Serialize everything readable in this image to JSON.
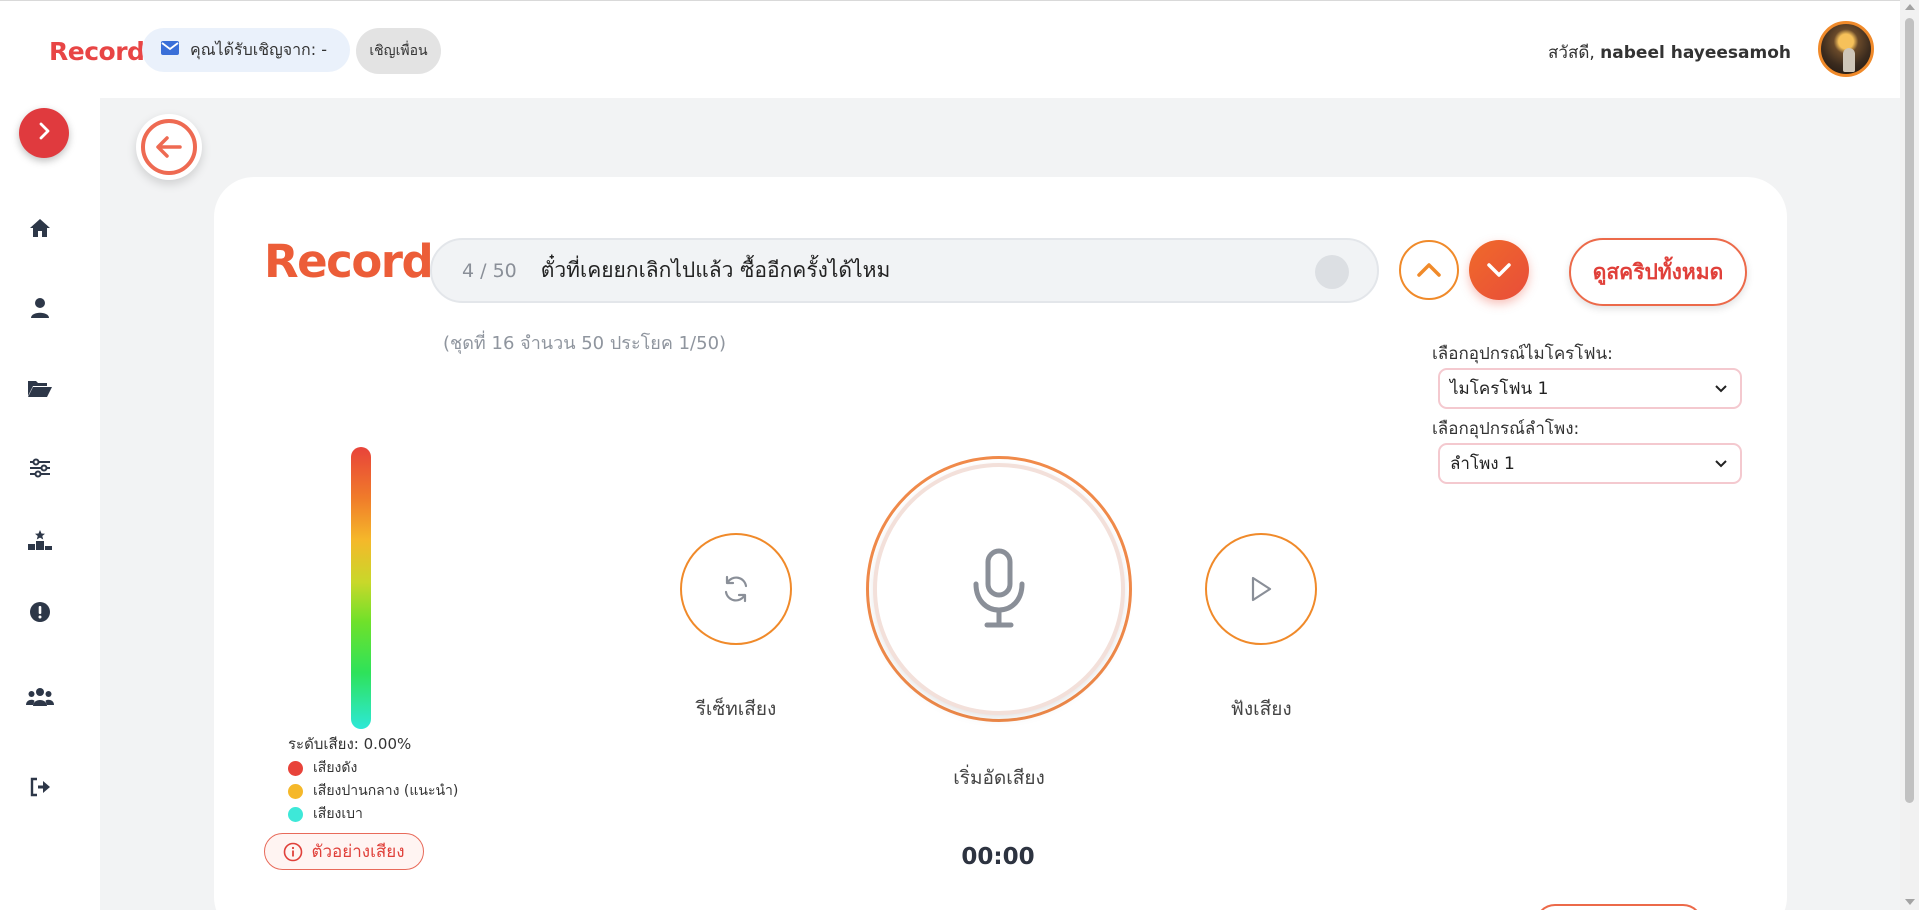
{
  "header": {
    "brand": "Record",
    "invite_text": "คุณได้รับเชิญจาก: -",
    "invite_friend_label": "เชิญเพื่อน",
    "greeting_prefix": "สวัสดี, ",
    "user_name": "nabeel hayeesamoh"
  },
  "sidebar": {
    "items": [
      {
        "icon": "home-icon"
      },
      {
        "icon": "user-icon"
      },
      {
        "icon": "folder-open-icon"
      },
      {
        "icon": "sliders-icon"
      },
      {
        "icon": "ranking-icon"
      },
      {
        "icon": "exclamation-circle-icon"
      },
      {
        "icon": "users-icon"
      },
      {
        "icon": "sign-out-icon"
      }
    ]
  },
  "main": {
    "title": "Record",
    "sentence_count": "4 / 50",
    "sentence_text": "ตั๋วที่เคยยกเลิกไปแล้ว ซื้ออีกครั้งได้ไหม",
    "view_all_label": "ดูสคริปทั้งหมด",
    "set_info": "(ชุดที่ 16 จำนวน 50 ประโยค 1/50)",
    "mic_label": "เลือกอุปกรณ์ไมโครโฟน:",
    "mic_value": "ไมโครโฟน 1",
    "speaker_label": "เลือกอุปกรณ์ลำโพง:",
    "speaker_value": "ลำโพง 1",
    "level_text": "ระดับเสียง: 0.00%",
    "level_value": 0.0,
    "legend": [
      {
        "label": "เสียงดัง",
        "color": "#e8433a"
      },
      {
        "label": "เสียงปานกลาง (แนะนำ)",
        "color": "#f5b82a"
      },
      {
        "label": "เสียงเบา",
        "color": "#3ee8d8"
      }
    ],
    "sample_label": "ตัวอย่างเสียง",
    "reset_label": "รีเซ็ทเสียง",
    "record_label": "เริ่มอัดเสียง",
    "play_label": "ฟังเสียง",
    "timer": "00:00"
  },
  "colors": {
    "accent": "#ec5d38",
    "brand_red": "#e84545",
    "orange_border": "#f08a2a"
  }
}
